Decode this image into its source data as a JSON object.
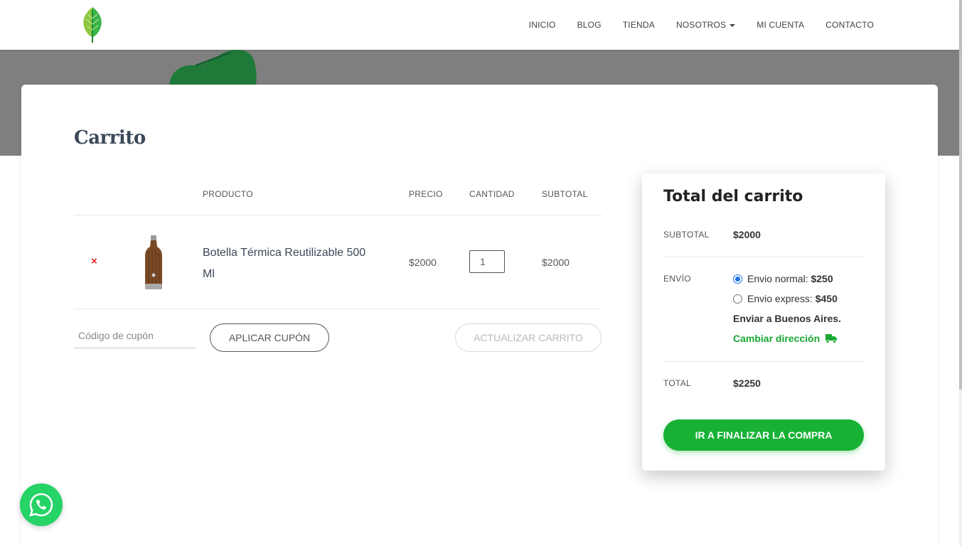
{
  "nav": {
    "items": [
      {
        "label": "INICIO"
      },
      {
        "label": "BLOG"
      },
      {
        "label": "TIENDA"
      },
      {
        "label": "NOSOTROS"
      },
      {
        "label": "MI CUENTA"
      },
      {
        "label": "CONTACTO"
      }
    ]
  },
  "page": {
    "title": "Carrito"
  },
  "cart": {
    "headers": {
      "product": "PRODUCTO",
      "price": "PRECIO",
      "quantity": "CANTIDAD",
      "subtotal": "SUBTOTAL"
    },
    "items": [
      {
        "remove": "×",
        "name": "Botella Térmica Reutilizable 500 Ml",
        "price": "$2000",
        "quantity": "1",
        "subtotal": "$2000"
      }
    ],
    "coupon_placeholder": "Código de cupón",
    "apply_label": "APLICAR CUPÓN",
    "update_label": "ACTUALIZAR CARRITO"
  },
  "totals": {
    "title": "Total del carrito",
    "subtotal_label": "SUBTOTAL",
    "subtotal_value": "$2000",
    "shipping_label": "ENVÍO",
    "shipping_options": [
      {
        "label": "Envio normal:",
        "price": "$250",
        "selected": true
      },
      {
        "label": "Envio express:",
        "price": "$450",
        "selected": false
      }
    ],
    "ship_to": "Enviar a Buenos Aires.",
    "change_address": "Cambiar dirección",
    "total_label": "TOTAL",
    "total_value": "$2250",
    "checkout_label": "IR A FINALIZAR LA COMPRA"
  },
  "colors": {
    "accent": "#17b235",
    "remove": "#e02020",
    "whatsapp": "#25d366",
    "hero": "#7f7f7f"
  },
  "icons": [
    "leaf-logo-icon",
    "caret-down-icon",
    "remove-icon",
    "truck-icon",
    "whatsapp-icon"
  ]
}
